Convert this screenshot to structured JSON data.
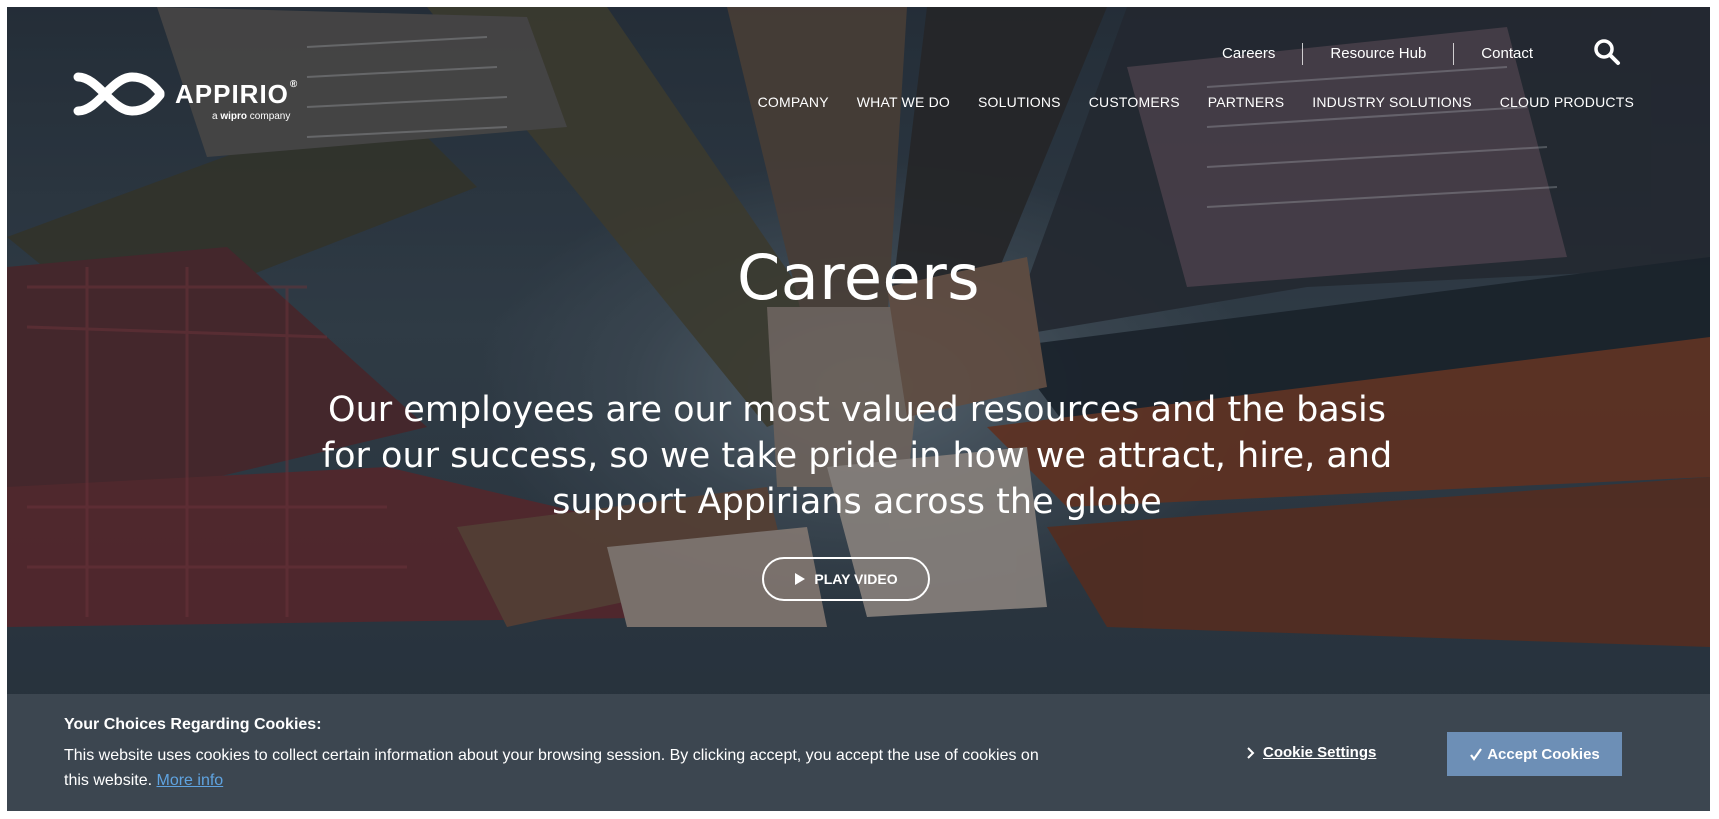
{
  "logo": {
    "name": "APPIRIO",
    "tm": "®",
    "tagline_prefix": "a",
    "tagline_brand": "wipro",
    "tagline_suffix": "company"
  },
  "utility_nav": {
    "items": [
      "Careers",
      "Resource Hub",
      "Contact"
    ],
    "search_icon": "search-icon"
  },
  "main_nav": {
    "items": [
      "COMPANY",
      "WHAT WE DO",
      "SOLUTIONS",
      "CUSTOMERS",
      "PARTNERS",
      "INDUSTRY SOLUTIONS",
      "CLOUD PRODUCTS"
    ]
  },
  "hero": {
    "title": "Careers",
    "subtitle": "Our employees are our most valued resources and the basis for our success, so we take pride in how we attract, hire, and support Appirians across the globe",
    "play_button_label": "PLAY VIDEO",
    "play_icon": "play-icon"
  },
  "cookie_banner": {
    "title": "Your Choices Regarding Cookies:",
    "text": "This website uses cookies to collect certain information about your browsing session. By clicking accept, you accept the use of cookies on this website.",
    "more_info_label": "More info",
    "settings_label": "Cookie Settings",
    "accept_label": "Accept Cookies",
    "accept_icon": "check-icon",
    "settings_icon": "chevron-right-icon"
  },
  "colors": {
    "cookie_bar_bg": "#3c4650",
    "accept_button_bg": "#6d8fb6",
    "link_color": "#5fa3e0"
  }
}
